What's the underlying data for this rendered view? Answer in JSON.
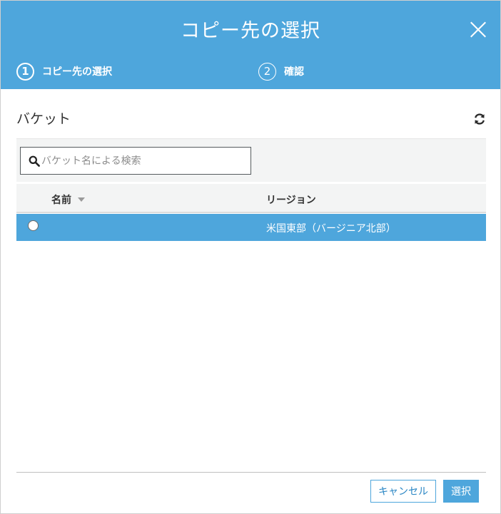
{
  "dialog": {
    "title": "コピー先の選択",
    "close_icon": "close-icon"
  },
  "steps": [
    {
      "number": "1",
      "label": "コピー先の選択",
      "active": true
    },
    {
      "number": "2",
      "label": "確認",
      "active": false
    }
  ],
  "bucket_section": {
    "title": "バケット",
    "refresh_icon": "refresh-icon"
  },
  "search": {
    "placeholder": "バケット名による検索",
    "value": ""
  },
  "table": {
    "columns": [
      {
        "label": "名前",
        "sorted": "descending"
      },
      {
        "label": "リージョン"
      }
    ],
    "rows": [
      {
        "name": "",
        "region": "米国東部（バージニア北部）",
        "selected": true
      }
    ]
  },
  "footer": {
    "cancel_label": "キャンセル",
    "select_label": "選択"
  },
  "colors": {
    "accent": "#4ea6dc",
    "header_text": "#ffffff",
    "toolbar_bg": "#f3f4f4"
  }
}
